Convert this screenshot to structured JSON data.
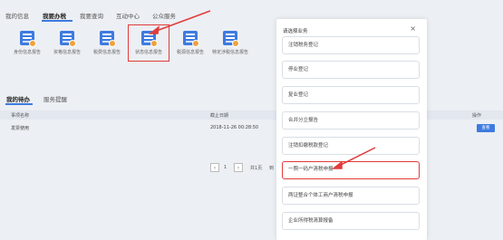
{
  "tabs": [
    {
      "label": "我的信息"
    },
    {
      "label": "我要办税"
    },
    {
      "label": "我要查询"
    },
    {
      "label": "互动中心"
    },
    {
      "label": "公众服务"
    }
  ],
  "icons": [
    {
      "label": "身份信息报告",
      "icon": "report-icon"
    },
    {
      "label": "资格信息报告",
      "icon": "report-icon"
    },
    {
      "label": "税费信息报告",
      "icon": "report-icon"
    },
    {
      "label": "状态信息报告",
      "icon": "report-icon"
    },
    {
      "label": "税源信息报告",
      "icon": "report-icon"
    },
    {
      "label": "特定涉税信息报告",
      "icon": "report-icon"
    }
  ],
  "section_tabs": [
    {
      "label": "我的待办"
    },
    {
      "label": "服务提醒"
    }
  ],
  "table": {
    "headers": [
      "事项名称",
      "截止日期",
      "操作"
    ],
    "rows": [
      {
        "name": "发票使用",
        "date": "2018-11-26 00:28:50",
        "action": "查看"
      }
    ]
  },
  "pager": {
    "prev": "‹",
    "page": "1",
    "next": "›",
    "total": "共1页",
    "goto": "到"
  },
  "modal": {
    "title": "请选择业务",
    "close": "×",
    "options": [
      {
        "label": "注销税务登记"
      },
      {
        "label": "停业登记"
      },
      {
        "label": "复业登记"
      },
      {
        "label": "合并分立报告"
      },
      {
        "label": "注销扣缴税款登记"
      },
      {
        "label": "一照一码户清税申报"
      },
      {
        "label": "两证整合个体工商户清税申报"
      },
      {
        "label": "企业所得税清算报备"
      }
    ]
  },
  "colors": {
    "accent": "#3e7be0",
    "highlight": "#e23b3b"
  }
}
